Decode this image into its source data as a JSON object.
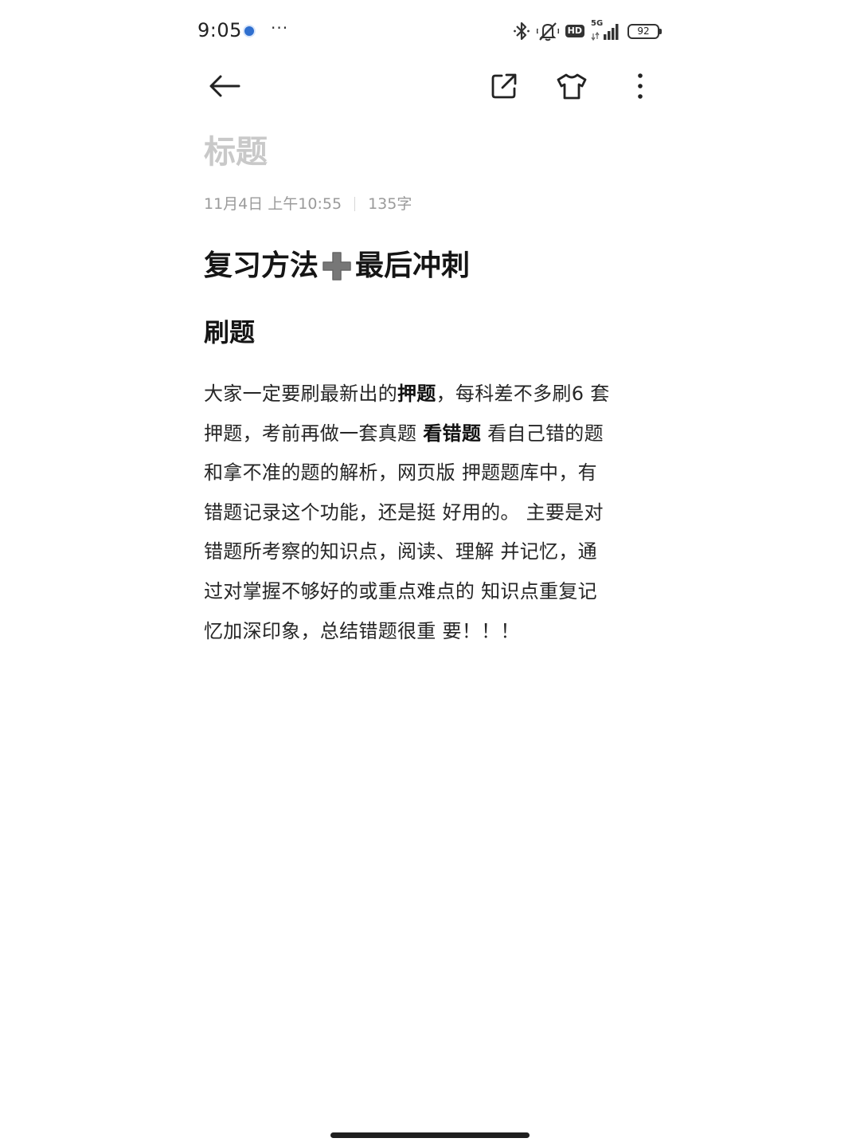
{
  "status_bar": {
    "time": "9:05",
    "more": "···",
    "hd": "HD",
    "network": "5G",
    "battery": "92"
  },
  "toolbar": {
    "back_icon": "arrow-left-icon",
    "share_icon": "share-icon",
    "theme_icon": "tshirt-icon",
    "more_icon": "more-vertical-icon"
  },
  "note": {
    "title_placeholder": "标题",
    "date": "11月4日 上午10:55",
    "word_count": "135字",
    "heading_part1": "复习方法",
    "heading_emoji": "plus-emoji",
    "heading_part2": "最后冲刺",
    "subheading": "刷题",
    "body": [
      [
        {
          "t": "大家一定要刷最新出的"
        },
        {
          "t": "押题",
          "b": true
        },
        {
          "t": "，每科差不多刷6 套"
        }
      ],
      [
        {
          "t": "押题，考前再做一套真题 "
        },
        {
          "t": "看错题",
          "b": true
        },
        {
          "t": " 看自己错的题"
        }
      ],
      [
        {
          "t": "和拿不准的题的解析，网页版 押题题库中，有"
        }
      ],
      [
        {
          "t": "错题记录这个功能，还是挺 好用的。 主要是对"
        }
      ],
      [
        {
          "t": "错题所考察的知识点，阅读、理解 并记忆，通"
        }
      ],
      [
        {
          "t": "过对掌握不够好的或重点难点的 知识点重复记"
        }
      ],
      [
        {
          "t": "忆加深印象，总结错题很重 要！！！"
        }
      ]
    ]
  },
  "colors": {
    "title_placeholder": "#c9c9c9",
    "meta": "#9a9a9a",
    "text": "#262626",
    "heading": "#151515",
    "emoji_plus": "#777777"
  }
}
